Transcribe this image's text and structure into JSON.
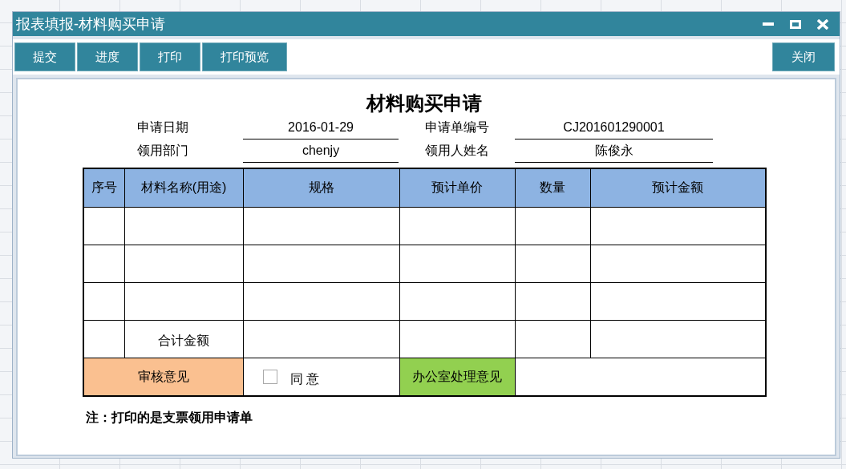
{
  "window": {
    "title": "报表填报-材料购买申请"
  },
  "toolbar": {
    "buttons": [
      "提交",
      "进度",
      "打印",
      "打印预览"
    ],
    "close_button": "关闭"
  },
  "form": {
    "title": "材料购买申请",
    "fields": [
      {
        "label": "申请日期",
        "value": "2016-01-29"
      },
      {
        "label": "申请单编号",
        "value": "CJ201601290001"
      },
      {
        "label": "领用部门",
        "value": "chenjy"
      },
      {
        "label": "领用人姓名",
        "value": "陈俊永"
      }
    ],
    "table": {
      "columns": [
        "序号",
        "材料名称(用途)",
        "规格",
        "预计单价",
        "数量",
        "预计金额"
      ],
      "total_label": "合计金额"
    },
    "review": {
      "label": "审核意见",
      "checkbox": {
        "label": "同 意",
        "checked": false
      },
      "office_label": "办公室处理意见"
    },
    "note": "注：打印的是支票领用申请单"
  }
}
